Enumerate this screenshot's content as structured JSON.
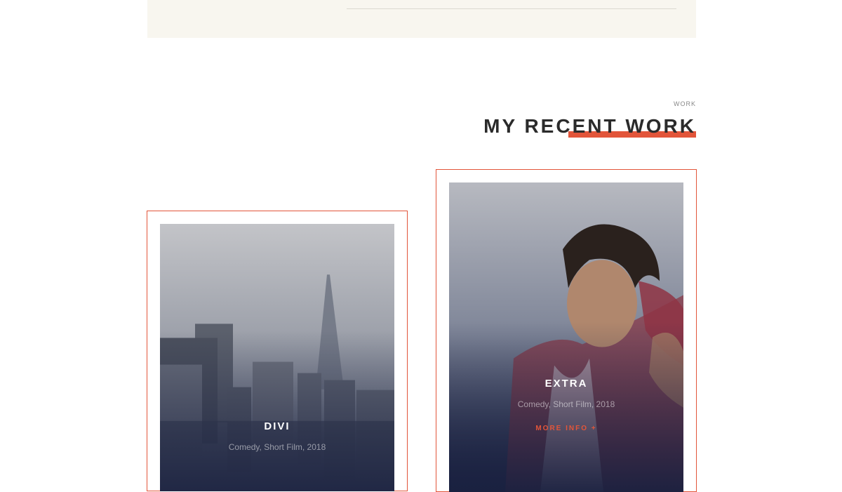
{
  "section": {
    "eyebrow": "WORK",
    "title": "MY RECENT WORK"
  },
  "colors": {
    "accent": "#e2553a",
    "band": "#f8f6ef",
    "overlay_dark": "#1a2140"
  },
  "projects": [
    {
      "title": "DIVI",
      "meta": "Comedy, Short Film, 2018"
    },
    {
      "title": "EXTRA",
      "meta": "Comedy, Short Film, 2018",
      "link_label": "MORE INFO +"
    }
  ]
}
